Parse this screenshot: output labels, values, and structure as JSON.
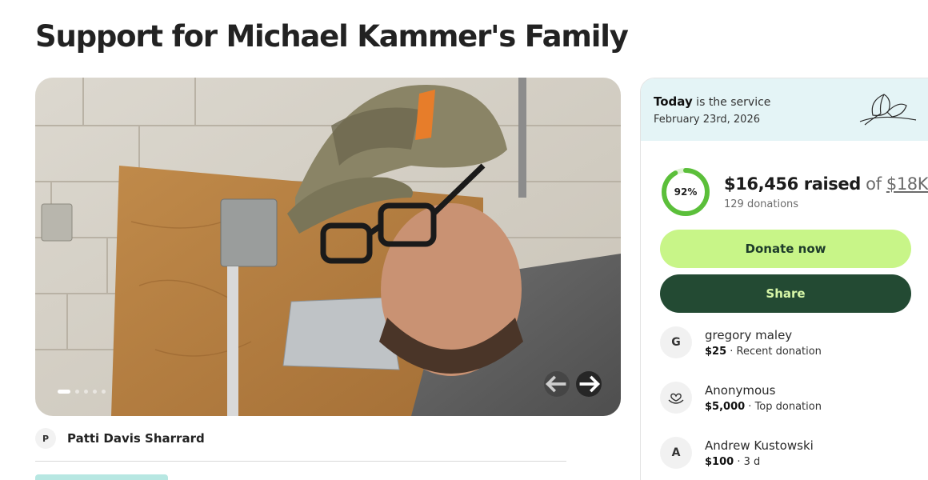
{
  "page": {
    "title": "Support for Michael Kammer's Family"
  },
  "gallery": {
    "photo_icon": "photo-of-man-in-camo-cap",
    "slide_count": 5,
    "active_slide": 1,
    "prev_icon": "arrow-left-icon",
    "next_icon": "arrow-right-icon"
  },
  "organizer": {
    "initial": "P",
    "name": "Patti Davis Sharrard"
  },
  "service": {
    "label_bold": "Today",
    "label_rest": " is the service",
    "date": "February 23rd, 2026",
    "icon": "calla-lily-icon"
  },
  "progress": {
    "percent": 92,
    "percent_label": "92%",
    "raised": "$16,456 raised",
    "of_label": " of ",
    "goal": "$18K",
    "donations": "129 donations"
  },
  "buttons": {
    "donate": "Donate now",
    "share": "Share"
  },
  "donors": [
    {
      "initial": "G",
      "name": "gregory maley",
      "amount": "$25",
      "note": " · Recent donation"
    },
    {
      "icon": "heart-hand-icon",
      "name": "Anonymous",
      "amount": "$5,000",
      "note": " · Top donation"
    },
    {
      "initial": "A",
      "name": "Andrew Kustowski",
      "amount": "$100",
      "note": " · 3 d"
    }
  ],
  "colors": {
    "donate_bg": "#c8f588",
    "share_bg": "#234a33",
    "ring": "#5bbf3a",
    "banner": "#e4f4f6"
  }
}
